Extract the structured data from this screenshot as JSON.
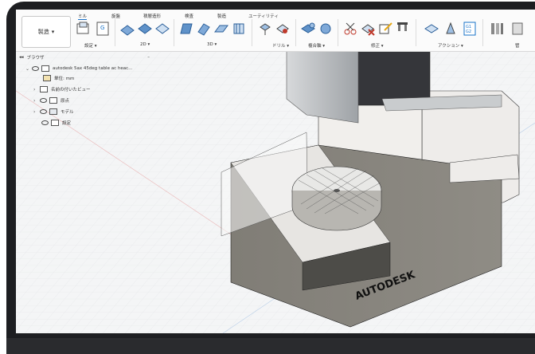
{
  "workspace": {
    "label": "製造"
  },
  "tabs": [
    "ミル",
    "旋盤",
    "積層造形",
    "検査",
    "製造",
    "ユーティリティ"
  ],
  "groups": [
    "設定",
    "2D",
    "3D",
    "ドリル",
    "複合軸",
    "修正",
    "アクション"
  ],
  "overflow_label": "管",
  "browser": {
    "title": "ブラウザ",
    "collapse": "–",
    "document": "autodesk 5ax 45deg table ac heac...",
    "items": [
      "単位: mm",
      "名前の付いたビュー",
      "原点",
      "モデル",
      "設定"
    ]
  },
  "brand": "AUTODESK",
  "colors": {
    "accent": "#1a73c9",
    "toolbar_bg": "#fbfbfb",
    "canvas_bg": "#f4f5f6",
    "machine_gray": "#8d8b84"
  }
}
